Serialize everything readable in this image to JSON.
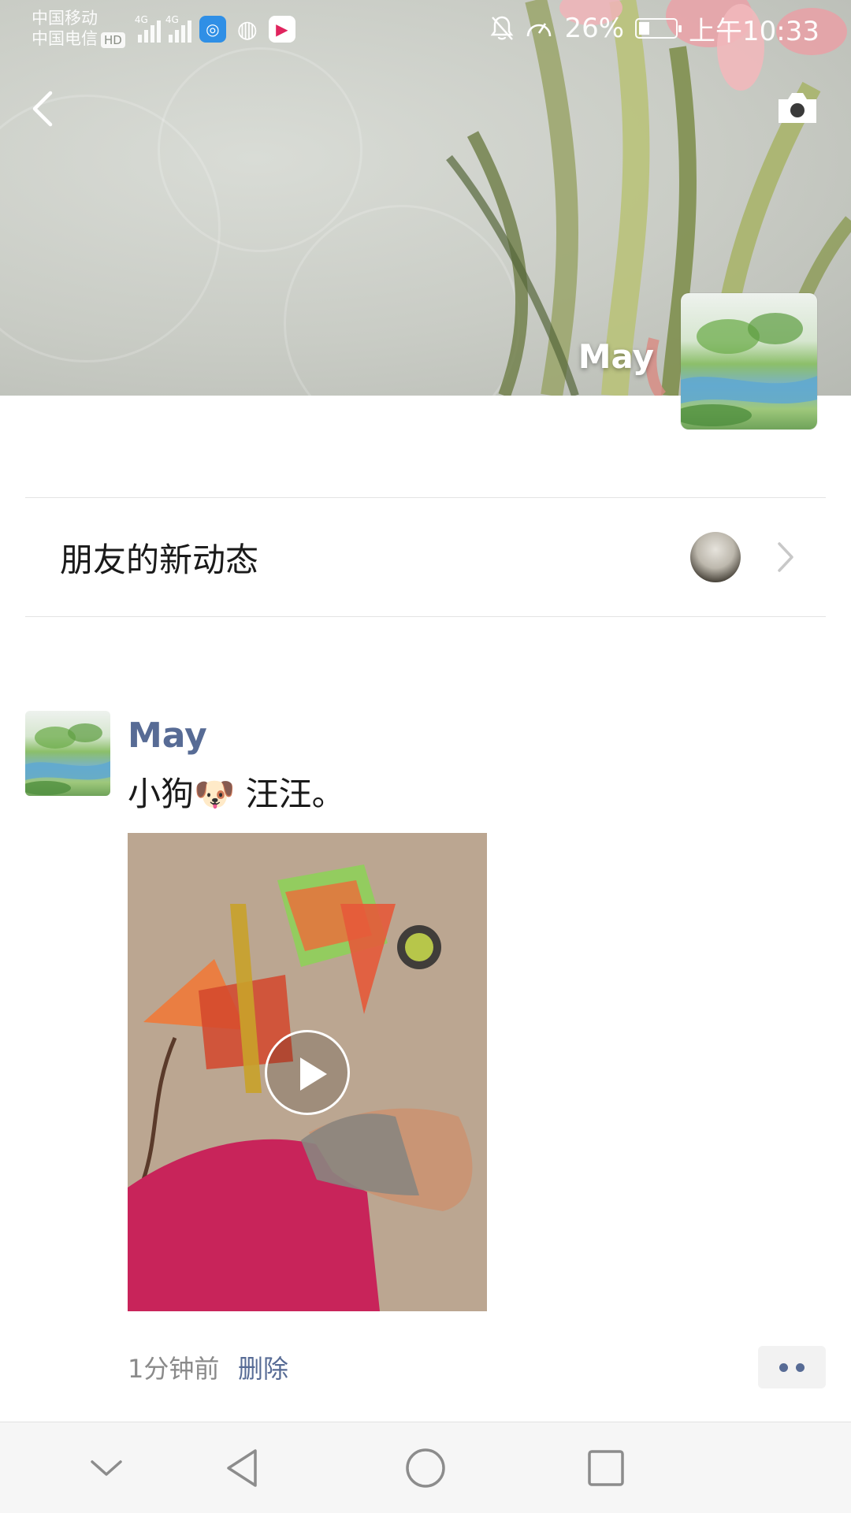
{
  "status_bar": {
    "carrier_1": "中国移动",
    "carrier_2": "中国电信",
    "hd_badge": "HD",
    "network_1": "4G",
    "network_2": "4G",
    "battery_percent": "26%",
    "battery_level": 0.26,
    "time": "上午10:33",
    "icons": [
      "signal-icon",
      "signal-icon",
      "browser-app-icon",
      "globe-icon",
      "video-app-icon",
      "mute-icon",
      "speed-icon",
      "battery-icon"
    ]
  },
  "header": {
    "back_icon": "back-arrow-icon",
    "camera_icon": "camera-icon",
    "user_name": "May"
  },
  "friends_updates": {
    "label": "朋友的新动态",
    "chevron_icon": "chevron-right-icon"
  },
  "post": {
    "author": "May",
    "text": "小狗🐶 汪汪。",
    "media_type": "video",
    "play_icon": "play-icon",
    "time": "1分钟前",
    "delete_label": "删除",
    "more_icon": "more-dots-icon"
  },
  "nav_bar": {
    "icons": [
      "nav-collapse-icon",
      "nav-back-icon",
      "nav-home-icon",
      "nav-recents-icon"
    ]
  },
  "colors": {
    "link_blue": "#576b95",
    "text_dark": "#1a1a1a",
    "text_gray": "#8a8a8a",
    "nav_bg": "#f6f6f6"
  }
}
